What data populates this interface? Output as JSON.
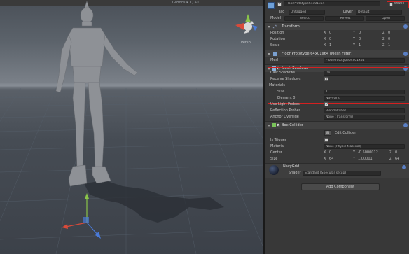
{
  "scene": {
    "toolbar_left": "Gizmos ▾",
    "toolbar_right": "Q All",
    "persp_label": "Persp"
  },
  "inspector": {
    "object_name": "FloorPrototype64x01x64",
    "static_label": "Static",
    "tag_label": "Tag",
    "tag_value": "Untagged",
    "layer_label": "Layer",
    "layer_value": "Default",
    "model_label": "Model",
    "model_buttons": [
      "Select",
      "Revert",
      "Open"
    ],
    "transform": {
      "title": "Transform",
      "rows": [
        {
          "label": "Position",
          "x": "0",
          "y": "0",
          "z": "0"
        },
        {
          "label": "Rotation",
          "x": "0",
          "y": "0",
          "z": "0"
        },
        {
          "label": "Scale",
          "x": "1",
          "y": "1",
          "z": "1"
        }
      ]
    },
    "mesh_filter": {
      "title": "Floor Prototype 64x01x64 (Mesh Filter)",
      "mesh_label": "Mesh",
      "mesh_value": "FloorPrototype64x01x64"
    },
    "mesh_renderer": {
      "title": "Mesh Renderer",
      "cast_label": "Cast Shadows",
      "cast_value": "On",
      "receive_label": "Receive Shadows",
      "materials_label": "Materials",
      "size_label": "Size",
      "size_value": "1",
      "element_label": "Element 0",
      "element_value": "NavyGrid",
      "light_probes_label": "Use Light Probes",
      "reflection_label": "Reflection Probes",
      "reflection_value": "Blend Probes",
      "anchor_label": "Anchor Override",
      "anchor_value": "None (Transform)"
    },
    "box_collider": {
      "title": "Box Collider",
      "edit_label": "Edit Collider",
      "trigger_label": "Is Trigger",
      "material_label": "Material",
      "material_value": "None (Physic Material)",
      "center_label": "Center",
      "center": {
        "x": "0",
        "y": "-0.5000012",
        "z": "0"
      },
      "size_label": "Size",
      "size": {
        "x": "64",
        "y": "1.00001",
        "z": "64"
      }
    },
    "material": {
      "name": "NavyGrid",
      "shader_label": "Shader",
      "shader_value": "Standard (Specular setup)"
    },
    "add_component": "Add Component"
  },
  "colors": {
    "highlight": "#d42020",
    "inspector_bg": "#383838",
    "scene_floor": "#3c4149"
  }
}
